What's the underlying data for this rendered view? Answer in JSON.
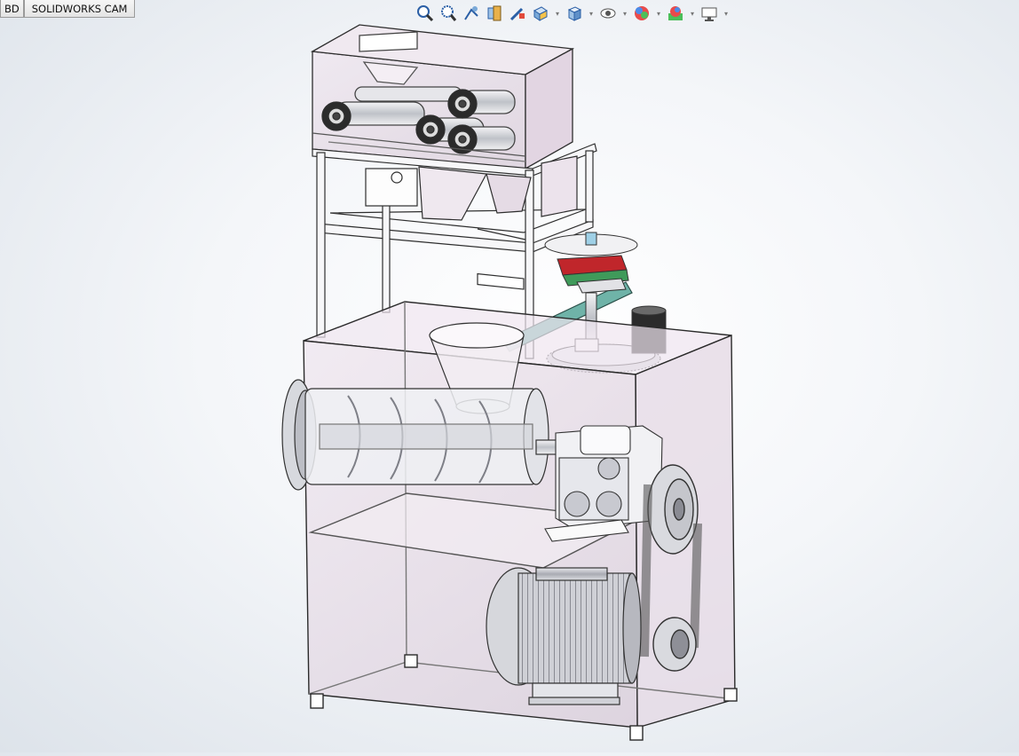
{
  "tabs": [
    "BD",
    "SOLIDWORKS CAM"
  ],
  "toolbar": {
    "icons": [
      "zoom-to-fit-icon",
      "zoom-to-area-icon",
      "previous-view-icon",
      "section-view-icon",
      "dynamic-annotation-icon",
      "view-orientation-icon",
      "display-style-icon",
      "hide-show-items-icon",
      "edit-appearance-icon",
      "apply-scene-icon",
      "view-settings-icon"
    ]
  },
  "model": {
    "description_colors": {
      "frame": "#3a3a3a",
      "glass": "#e8dbe8",
      "gear_red": "#c0262b",
      "gear_green": "#3f9a5a",
      "chute_teal": "#6fb3a8"
    }
  }
}
